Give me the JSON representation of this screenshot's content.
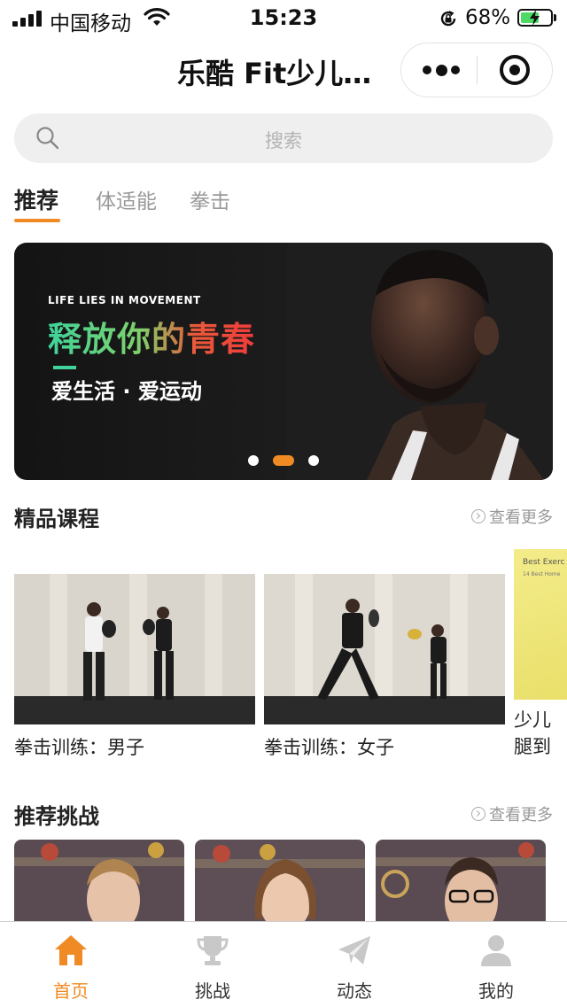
{
  "status_bar": {
    "carrier": "中国移动",
    "time": "15:23",
    "battery_percent": "68%",
    "battery_level": 0.68
  },
  "header": {
    "title": "乐酷 Fit少儿…"
  },
  "search": {
    "placeholder": "搜索"
  },
  "tabs": [
    {
      "label": "推荐",
      "active": true
    },
    {
      "label": "体适能",
      "active": false
    },
    {
      "label": "拳击",
      "active": false
    }
  ],
  "banner": {
    "small_text": "LIFE LIES IN MOVEMENT",
    "headline": "释放你的青春",
    "subline": "爱生活 · 爱运动",
    "active_slide": 2,
    "slide_count": 3
  },
  "courses_section": {
    "title": "精品课程",
    "more_label": "查看更多",
    "items": [
      {
        "caption": "拳击训练：男子"
      },
      {
        "caption": "拳击训练：女子"
      },
      {
        "caption_line1": "少儿",
        "caption_line2": "腿到",
        "thumb_title": "Best Exerc",
        "thumb_subtitle": "14 Best Home"
      }
    ]
  },
  "challenges_section": {
    "title": "推荐挑战",
    "more_label": "查看更多"
  },
  "tabbar": {
    "items": [
      {
        "label": "首页",
        "icon": "home-icon",
        "active": true
      },
      {
        "label": "挑战",
        "icon": "trophy-icon",
        "active": false
      },
      {
        "label": "动态",
        "icon": "paper-plane-icon",
        "active": false
      },
      {
        "label": "我的",
        "icon": "user-icon",
        "active": false
      }
    ]
  },
  "colors": {
    "accent": "#f08a24",
    "inactive_icon": "#c8c8c8"
  }
}
